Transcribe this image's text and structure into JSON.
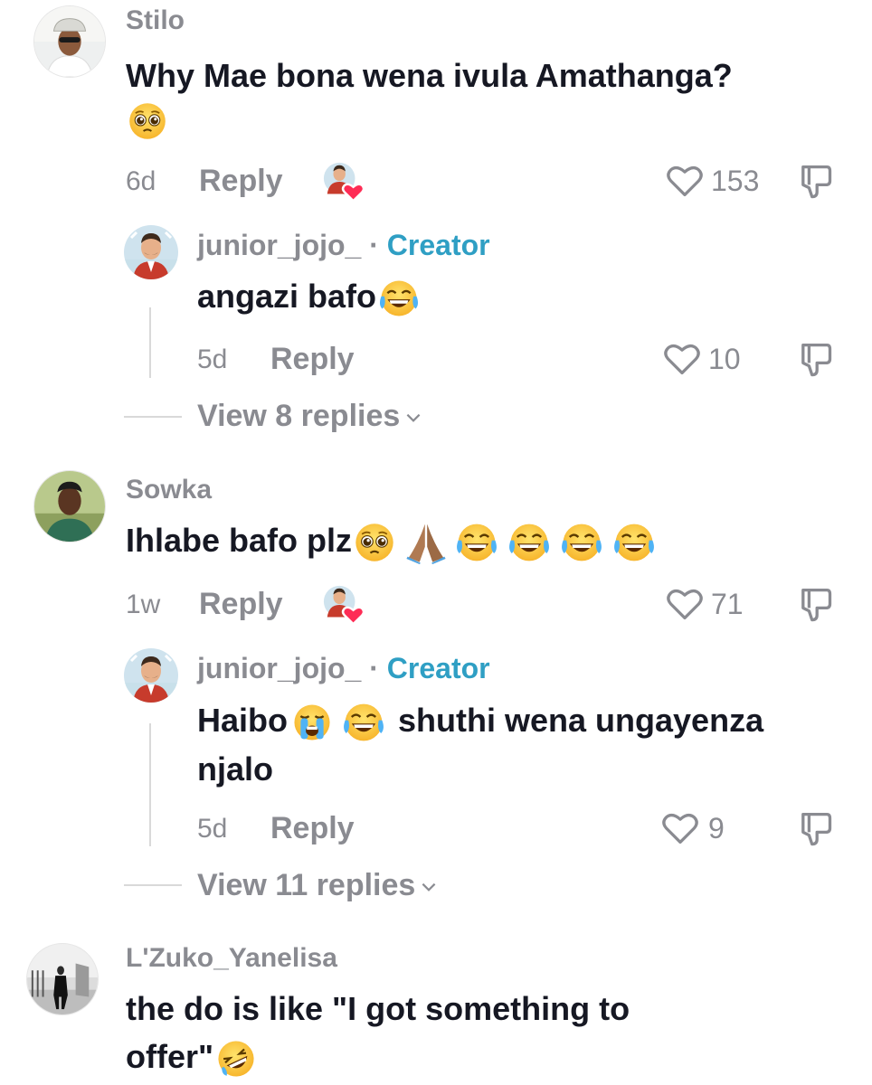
{
  "colors": {
    "text": "#161823",
    "muted": "#8a8b91",
    "creator": "#2f9fc4",
    "divider": "#d9d9d9"
  },
  "comments": [
    {
      "username": "Stilo",
      "text": "Why Mae bona wena ivula Amathanga?",
      "emojis": [
        "pleading-face"
      ],
      "time": "6d",
      "reply_label": "Reply",
      "likes": "153",
      "creator_liked": true,
      "reply": {
        "username": "junior_jojo_",
        "separator": "·",
        "badge": "Creator",
        "text": "angazi bafo",
        "emojis": [
          "tears-of-joy"
        ],
        "time": "5d",
        "reply_label": "Reply",
        "likes": "10"
      },
      "view_replies": "View 8 replies"
    },
    {
      "username": "Sowka",
      "text": "Ihlabe bafo plz",
      "emojis": [
        "pleading-face",
        "folded-hands",
        "tears-of-joy",
        "tears-of-joy",
        "tears-of-joy",
        "tears-of-joy"
      ],
      "time": "1w",
      "reply_label": "Reply",
      "likes": "71",
      "creator_liked": true,
      "reply": {
        "username": "junior_jojo_",
        "separator": "·",
        "badge": "Creator",
        "text_before": "Haibo",
        "text_after": "shuthi wena ungayenza",
        "text_line2": "njalo",
        "emojis": [
          "crying-face",
          "tears-of-joy"
        ],
        "time": "5d",
        "reply_label": "Reply",
        "likes": "9"
      },
      "view_replies": "View 11 replies"
    },
    {
      "username": "L'Zuko_Yanelisa",
      "text_line1": "the do is like \"I got something to",
      "text_line2": "offer\"",
      "emojis": [
        "rofl"
      ]
    }
  ]
}
